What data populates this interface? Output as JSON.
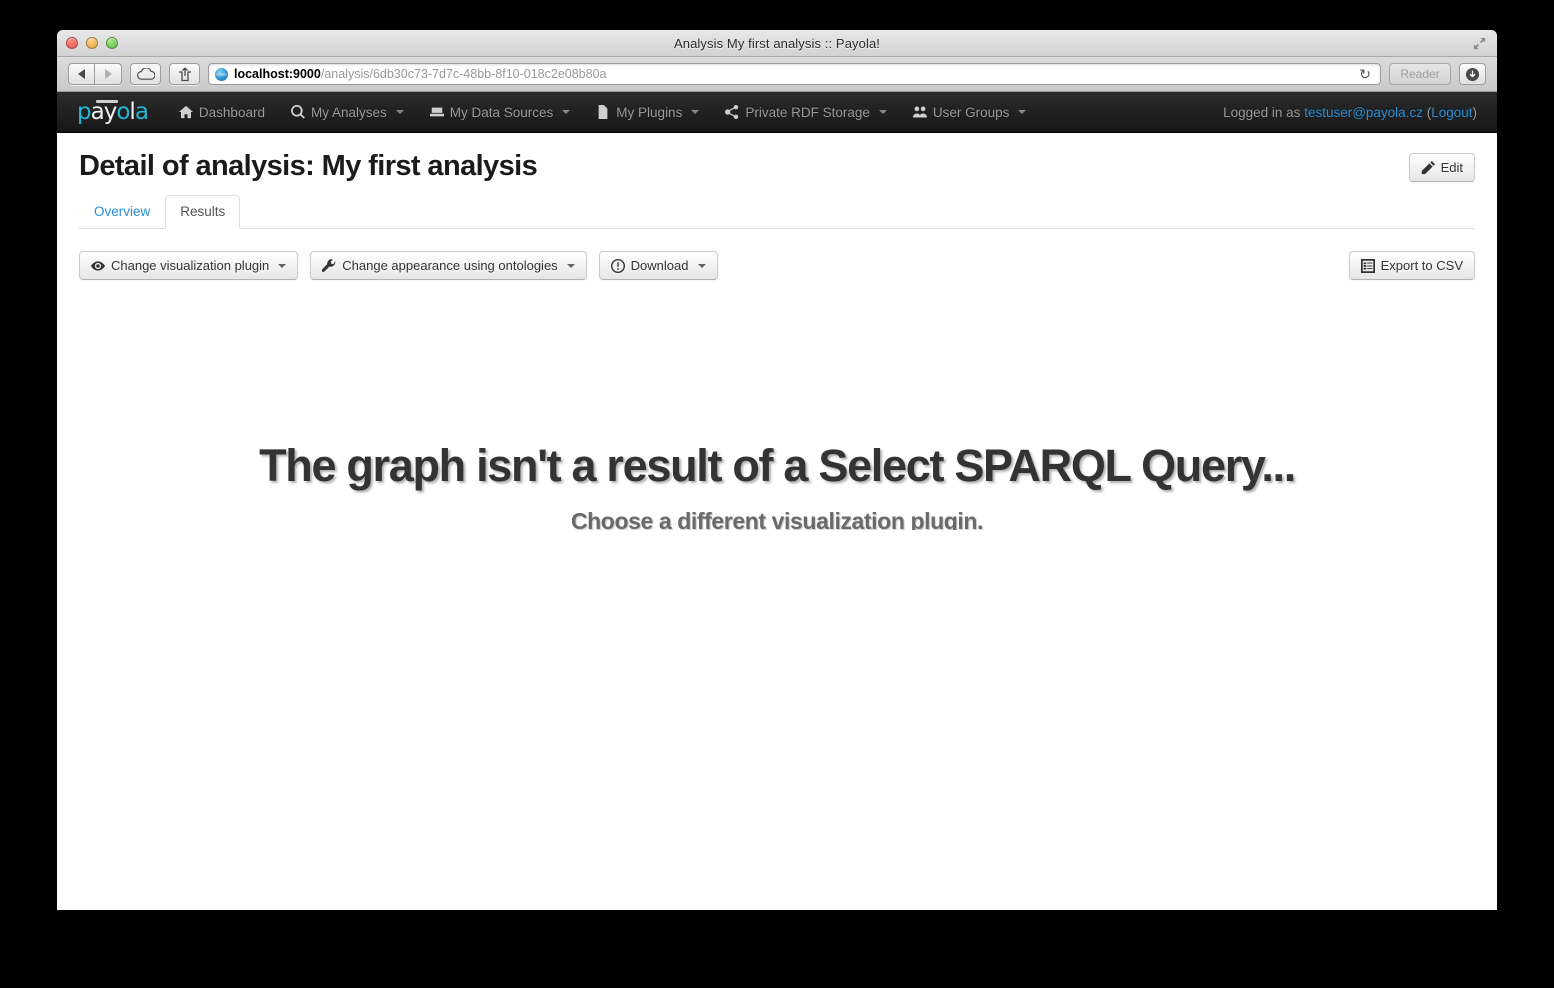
{
  "window": {
    "title": "Analysis My first analysis :: Payola!",
    "traffic_lights": [
      "close-button",
      "minimize-button",
      "maximize-button"
    ],
    "fullscreen_icon": "fullscreen-icon"
  },
  "browser": {
    "back_icon": "back-arrow-icon",
    "forward_icon": "forward-arrow-icon",
    "icloud_icon": "icloud-icon",
    "share_icon": "share-icon",
    "site_icon": "globe-icon",
    "url_host": "localhost:9000",
    "url_path": "/analysis/6db30c73-7d7c-48bb-8f10-018c2e08b80a",
    "url_full": "localhost:9000/analysis/6db30c73-7d7c-48bb-8f10-018c2e08b80a",
    "reload_icon": "reload-icon",
    "reader_label": "Reader",
    "downloads_icon": "downloads-icon"
  },
  "navbar": {
    "brand": "payola",
    "brand_accent": "#22b6d4",
    "items": [
      {
        "label": "Dashboard",
        "icon": "home-icon",
        "caret": false
      },
      {
        "label": "My Analyses",
        "icon": "search-icon",
        "caret": true
      },
      {
        "label": "My Data Sources",
        "icon": "database-icon",
        "caret": true
      },
      {
        "label": "My Plugins",
        "icon": "file-icon",
        "caret": true
      },
      {
        "label": "Private RDF Storage",
        "icon": "share-nodes-icon",
        "caret": true
      },
      {
        "label": "User Groups",
        "icon": "users-icon",
        "caret": true
      }
    ],
    "login_prefix": "Logged in as ",
    "login_user": "testuser@payola.cz",
    "login_open_paren": " (",
    "logout_label": "Logout",
    "login_close_paren": ")",
    "link_color": "#2a8fd4"
  },
  "header": {
    "title": "Detail of analysis: My first analysis",
    "edit_label": "Edit",
    "edit_icon": "pencil-icon"
  },
  "tabs": [
    {
      "label": "Overview",
      "active": false
    },
    {
      "label": "Results",
      "active": true
    }
  ],
  "toolbar": {
    "change_plugin_label": "Change visualization plugin",
    "change_plugin_icon": "eye-icon",
    "change_appearance_label": "Change appearance using ontologies",
    "change_appearance_icon": "wrench-icon",
    "download_label": "Download",
    "download_icon": "download-circle-icon",
    "export_csv_label": "Export to CSV",
    "export_csv_icon": "list-icon"
  },
  "message": {
    "title": "The graph isn't a result of a Select SPARQL Query...",
    "subtitle": "Choose a different visualization plugin."
  }
}
